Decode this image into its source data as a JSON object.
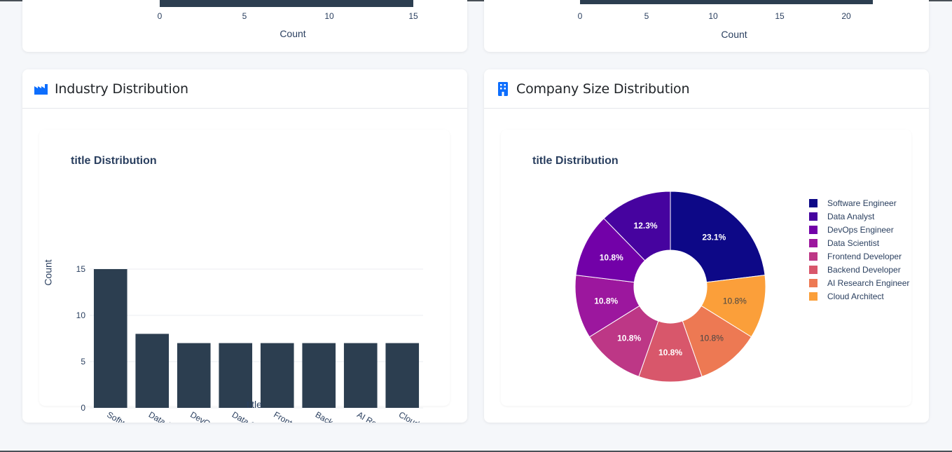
{
  "top_left": {
    "x_ticks": [
      "0",
      "5",
      "10",
      "15"
    ],
    "x_label": "Count"
  },
  "top_right": {
    "x_ticks": [
      "0",
      "5",
      "10",
      "15",
      "20"
    ],
    "x_label": "Count"
  },
  "industry_card": {
    "title": "Industry Distribution",
    "icon": "industry-icon"
  },
  "company_card": {
    "title": "Company Size Distribution",
    "icon": "building-icon"
  },
  "colors": {
    "bar": "#2c3e50",
    "accent_icon": "#0d6efd",
    "pie": [
      "#0d0887",
      "#46039f",
      "#7201a8",
      "#9c179e",
      "#bd3786",
      "#d8576b",
      "#ed7953",
      "#fb9f3a"
    ]
  },
  "chart_data": [
    {
      "type": "bar",
      "title": "title Distribution",
      "xlabel": "title",
      "ylabel": "Count",
      "categories": [
        "Software Engineer",
        "Data Analyst",
        "DevOps Engineer",
        "Data Scientist",
        "Frontend Developer",
        "Backend Developer",
        "AI Research Engineer",
        "Cloud Architect"
      ],
      "values": [
        15,
        8,
        7,
        7,
        7,
        7,
        7,
        7
      ],
      "ylim": [
        0,
        16
      ],
      "y_ticks": [
        0,
        5,
        10,
        15
      ],
      "grid": true
    },
    {
      "type": "pie",
      "title": "title Distribution",
      "hole": true,
      "legend": "right",
      "labels": [
        "Software Engineer",
        "Data Analyst",
        "DevOps Engineer",
        "Data Scientist",
        "Frontend Developer",
        "Backend Developer",
        "AI Research Engineer",
        "Cloud Architect"
      ],
      "values": [
        15,
        8,
        7,
        7,
        7,
        7,
        7,
        7
      ],
      "percent_labels": [
        "23.1%",
        "12.3%",
        "10.8%",
        "10.8%",
        "10.8%",
        "10.8%",
        "10.8%",
        "10.8%"
      ]
    }
  ]
}
